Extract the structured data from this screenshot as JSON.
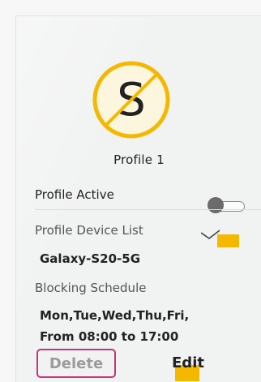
{
  "colors": {
    "accent_yellow": "#f5b800",
    "delete_border": "#c2357c",
    "delete_text": "#9b9b9b",
    "toggle_off": "#6b6b6b"
  },
  "profile": {
    "avatar_letter": "S",
    "avatar_icon": "blocked-profile-icon",
    "name": "Profile 1",
    "active_label": "Profile Active",
    "active": false
  },
  "device_list": {
    "label": "Profile Device List",
    "toggle_icon": "chevron-down-icon",
    "device": "Galaxy-S20-5G"
  },
  "schedule": {
    "label": "Blocking Schedule",
    "days": "Mon,Tue,Wed,Thu,Fri,",
    "time": "From 08:00 to 17:00"
  },
  "actions": {
    "delete_label": "Delete",
    "edit_label": "Edit"
  }
}
